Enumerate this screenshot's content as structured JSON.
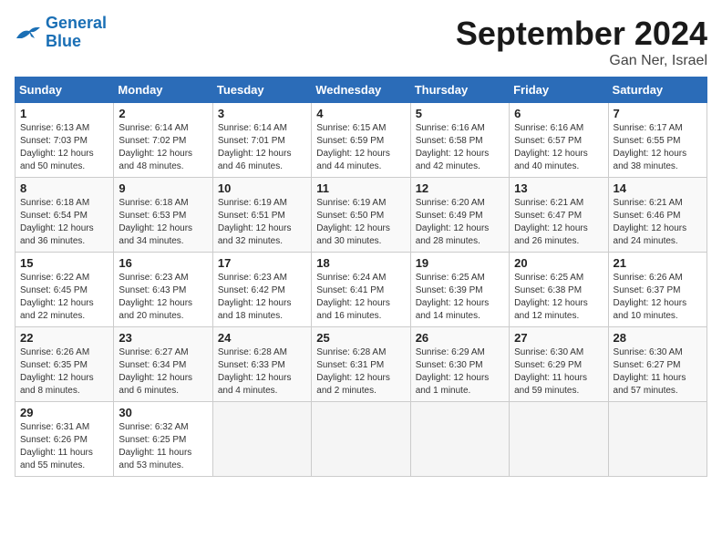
{
  "logo": {
    "line1": "General",
    "line2": "Blue"
  },
  "title": "September 2024",
  "location": "Gan Ner, Israel",
  "days_of_week": [
    "Sunday",
    "Monday",
    "Tuesday",
    "Wednesday",
    "Thursday",
    "Friday",
    "Saturday"
  ],
  "weeks": [
    [
      {
        "day": "1",
        "info": "Sunrise: 6:13 AM\nSunset: 7:03 PM\nDaylight: 12 hours\nand 50 minutes."
      },
      {
        "day": "2",
        "info": "Sunrise: 6:14 AM\nSunset: 7:02 PM\nDaylight: 12 hours\nand 48 minutes."
      },
      {
        "day": "3",
        "info": "Sunrise: 6:14 AM\nSunset: 7:01 PM\nDaylight: 12 hours\nand 46 minutes."
      },
      {
        "day": "4",
        "info": "Sunrise: 6:15 AM\nSunset: 6:59 PM\nDaylight: 12 hours\nand 44 minutes."
      },
      {
        "day": "5",
        "info": "Sunrise: 6:16 AM\nSunset: 6:58 PM\nDaylight: 12 hours\nand 42 minutes."
      },
      {
        "day": "6",
        "info": "Sunrise: 6:16 AM\nSunset: 6:57 PM\nDaylight: 12 hours\nand 40 minutes."
      },
      {
        "day": "7",
        "info": "Sunrise: 6:17 AM\nSunset: 6:55 PM\nDaylight: 12 hours\nand 38 minutes."
      }
    ],
    [
      {
        "day": "8",
        "info": "Sunrise: 6:18 AM\nSunset: 6:54 PM\nDaylight: 12 hours\nand 36 minutes."
      },
      {
        "day": "9",
        "info": "Sunrise: 6:18 AM\nSunset: 6:53 PM\nDaylight: 12 hours\nand 34 minutes."
      },
      {
        "day": "10",
        "info": "Sunrise: 6:19 AM\nSunset: 6:51 PM\nDaylight: 12 hours\nand 32 minutes."
      },
      {
        "day": "11",
        "info": "Sunrise: 6:19 AM\nSunset: 6:50 PM\nDaylight: 12 hours\nand 30 minutes."
      },
      {
        "day": "12",
        "info": "Sunrise: 6:20 AM\nSunset: 6:49 PM\nDaylight: 12 hours\nand 28 minutes."
      },
      {
        "day": "13",
        "info": "Sunrise: 6:21 AM\nSunset: 6:47 PM\nDaylight: 12 hours\nand 26 minutes."
      },
      {
        "day": "14",
        "info": "Sunrise: 6:21 AM\nSunset: 6:46 PM\nDaylight: 12 hours\nand 24 minutes."
      }
    ],
    [
      {
        "day": "15",
        "info": "Sunrise: 6:22 AM\nSunset: 6:45 PM\nDaylight: 12 hours\nand 22 minutes."
      },
      {
        "day": "16",
        "info": "Sunrise: 6:23 AM\nSunset: 6:43 PM\nDaylight: 12 hours\nand 20 minutes."
      },
      {
        "day": "17",
        "info": "Sunrise: 6:23 AM\nSunset: 6:42 PM\nDaylight: 12 hours\nand 18 minutes."
      },
      {
        "day": "18",
        "info": "Sunrise: 6:24 AM\nSunset: 6:41 PM\nDaylight: 12 hours\nand 16 minutes."
      },
      {
        "day": "19",
        "info": "Sunrise: 6:25 AM\nSunset: 6:39 PM\nDaylight: 12 hours\nand 14 minutes."
      },
      {
        "day": "20",
        "info": "Sunrise: 6:25 AM\nSunset: 6:38 PM\nDaylight: 12 hours\nand 12 minutes."
      },
      {
        "day": "21",
        "info": "Sunrise: 6:26 AM\nSunset: 6:37 PM\nDaylight: 12 hours\nand 10 minutes."
      }
    ],
    [
      {
        "day": "22",
        "info": "Sunrise: 6:26 AM\nSunset: 6:35 PM\nDaylight: 12 hours\nand 8 minutes."
      },
      {
        "day": "23",
        "info": "Sunrise: 6:27 AM\nSunset: 6:34 PM\nDaylight: 12 hours\nand 6 minutes."
      },
      {
        "day": "24",
        "info": "Sunrise: 6:28 AM\nSunset: 6:33 PM\nDaylight: 12 hours\nand 4 minutes."
      },
      {
        "day": "25",
        "info": "Sunrise: 6:28 AM\nSunset: 6:31 PM\nDaylight: 12 hours\nand 2 minutes."
      },
      {
        "day": "26",
        "info": "Sunrise: 6:29 AM\nSunset: 6:30 PM\nDaylight: 12 hours\nand 1 minute."
      },
      {
        "day": "27",
        "info": "Sunrise: 6:30 AM\nSunset: 6:29 PM\nDaylight: 11 hours\nand 59 minutes."
      },
      {
        "day": "28",
        "info": "Sunrise: 6:30 AM\nSunset: 6:27 PM\nDaylight: 11 hours\nand 57 minutes."
      }
    ],
    [
      {
        "day": "29",
        "info": "Sunrise: 6:31 AM\nSunset: 6:26 PM\nDaylight: 11 hours\nand 55 minutes."
      },
      {
        "day": "30",
        "info": "Sunrise: 6:32 AM\nSunset: 6:25 PM\nDaylight: 11 hours\nand 53 minutes."
      },
      {
        "day": "",
        "info": ""
      },
      {
        "day": "",
        "info": ""
      },
      {
        "day": "",
        "info": ""
      },
      {
        "day": "",
        "info": ""
      },
      {
        "day": "",
        "info": ""
      }
    ]
  ]
}
